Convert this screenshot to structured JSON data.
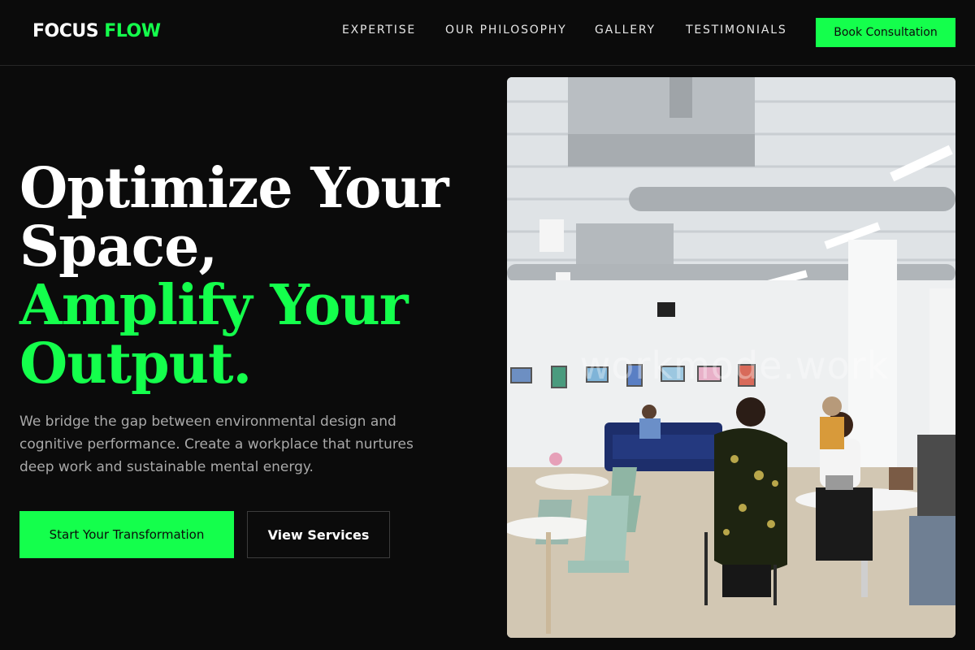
{
  "brand": {
    "part1": "FOCUS",
    "part2": "FLOW"
  },
  "nav": {
    "items": [
      {
        "label": "EXPERTISE"
      },
      {
        "label": "OUR PHILOSOPHY"
      },
      {
        "label": "GALLERY"
      },
      {
        "label": "TESTIMONIALS"
      }
    ],
    "cta_label": "Book Consultation"
  },
  "hero": {
    "title_line1": "Optimize Your",
    "title_line2": "Space,",
    "title_line3": "Amplify Your",
    "title_line4": "Output.",
    "description": "We bridge the gap between environmental design and cognitive performance. Create a workplace that nurtures deep work and sustainable mental energy.",
    "primary_button": "Start Your Transformation",
    "secondary_button": "View Services"
  },
  "image": {
    "watermark": "workmode.work"
  },
  "colors": {
    "accent": "#14ff4c",
    "background": "#0b0b0b",
    "text": "#ffffff",
    "muted_text": "#a9a9a9"
  }
}
